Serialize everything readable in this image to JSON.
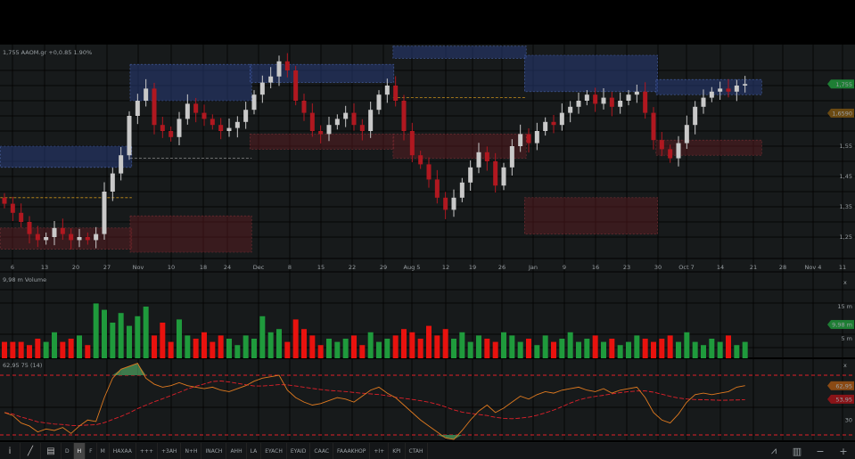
{
  "header": {
    "quote_line": "1,755 AAOM.gr +0,0.85 1.90%"
  },
  "price_axis": {
    "ticks": [
      {
        "label": "1,55",
        "value": 1.55
      },
      {
        "label": "1,45",
        "value": 1.45
      },
      {
        "label": "1,35",
        "value": 1.35
      },
      {
        "label": "1,25",
        "value": 1.25
      }
    ],
    "last_price_label": "1,755",
    "last_price_value": 1.755,
    "ref_price_label": "1,6590",
    "ref_price_value": 1.659,
    "last_color": "#1e7e34",
    "ref_color": "#6b4a12"
  },
  "x_axis": {
    "labels": [
      "6",
      "13",
      "20",
      "27",
      "Nov",
      "10",
      "18",
      "24",
      "Dec",
      "8",
      "15",
      "22",
      "29",
      "Aug 5",
      "12",
      "19",
      "26",
      "Jan",
      "9",
      "16",
      "23",
      "30",
      "Oct 7",
      "14",
      "21",
      "28",
      "Nov 4",
      "11"
    ]
  },
  "volume_panel": {
    "title": "9,98 m Volume",
    "close_label": "x",
    "ticks": [
      {
        "label": "15 m",
        "value": 15
      },
      {
        "label": "5 m",
        "value": 5
      }
    ],
    "last_label": "9,98 m"
  },
  "rsi_panel": {
    "title": "62,95 75 (14)",
    "close_label": "x",
    "upper": 70,
    "lower": 30,
    "value_label": "62,95",
    "value": 62.95,
    "ma_label": "53,95",
    "ma_value": 53.95,
    "extra_label": "30"
  },
  "chart_data": {
    "type": "candlestick",
    "ylim": [
      1.2,
      1.87
    ],
    "colors": {
      "up": "#c9c9c9",
      "down": "#b01820",
      "vol_up": "#1f9a3c",
      "vol_down": "#e8120e",
      "rsi": "#e07a1f",
      "rsi_ma": "#e0202a"
    },
    "closes": [
      1.36,
      1.33,
      1.3,
      1.26,
      1.24,
      1.25,
      1.28,
      1.26,
      1.24,
      1.25,
      1.24,
      1.26,
      1.4,
      1.46,
      1.52,
      1.65,
      1.7,
      1.74,
      1.62,
      1.6,
      1.58,
      1.64,
      1.69,
      1.66,
      1.64,
      1.62,
      1.6,
      1.61,
      1.63,
      1.67,
      1.72,
      1.76,
      1.78,
      1.83,
      1.8,
      1.7,
      1.66,
      1.6,
      1.59,
      1.62,
      1.64,
      1.66,
      1.62,
      1.6,
      1.67,
      1.72,
      1.75,
      1.7,
      1.6,
      1.52,
      1.49,
      1.44,
      1.38,
      1.34,
      1.38,
      1.43,
      1.48,
      1.53,
      1.5,
      1.42,
      1.48,
      1.55,
      1.59,
      1.56,
      1.6,
      1.63,
      1.62,
      1.66,
      1.68,
      1.7,
      1.72,
      1.69,
      1.71,
      1.68,
      1.7,
      1.72,
      1.73,
      1.66,
      1.57,
      1.54,
      1.51,
      1.56,
      1.62,
      1.68,
      1.71,
      1.73,
      1.74,
      1.73,
      1.75,
      1.755
    ],
    "volumes_m": [
      4,
      4,
      4,
      3,
      5,
      4,
      7,
      4,
      5,
      6,
      3,
      16,
      14,
      10,
      13,
      9,
      12,
      15,
      6,
      10,
      4,
      11,
      6,
      5,
      7,
      4,
      6,
      5,
      3,
      6,
      5,
      12,
      7,
      8,
      4,
      11,
      8,
      6,
      3,
      5,
      4,
      5,
      6,
      3,
      7,
      4,
      5,
      6,
      8,
      7,
      5,
      9,
      6,
      8,
      5,
      7,
      4,
      6,
      5,
      4,
      7,
      6,
      4,
      5,
      3,
      6,
      4,
      5,
      7,
      4,
      5,
      6,
      4,
      5,
      3,
      4,
      6,
      5,
      4,
      5,
      6,
      4,
      7,
      4,
      3,
      5,
      4,
      6,
      3,
      4
    ],
    "rsi": [
      45,
      43,
      38,
      36,
      32,
      34,
      33,
      35,
      31,
      36,
      40,
      39,
      55,
      68,
      74,
      76,
      78,
      68,
      64,
      62,
      63,
      65,
      63,
      62,
      61,
      62,
      60,
      59,
      61,
      63,
      66,
      68,
      69,
      70,
      60,
      55,
      52,
      50,
      51,
      53,
      55,
      54,
      52,
      56,
      60,
      62,
      58,
      55,
      50,
      45,
      40,
      36,
      32,
      28,
      27,
      33,
      40,
      46,
      50,
      45,
      48,
      52,
      56,
      54,
      57,
      59,
      58,
      60,
      61,
      62,
      60,
      59,
      61,
      58,
      60,
      61,
      62,
      55,
      45,
      40,
      38,
      44,
      52,
      57,
      58,
      57,
      58,
      59,
      62,
      63
    ],
    "supply_zones": [
      {
        "from": 0,
        "to": 15.3,
        "high": 1.55,
        "low": 1.48
      },
      {
        "from": 15.6,
        "to": 29.7,
        "high": 1.82,
        "low": 1.7
      },
      {
        "from": 30,
        "to": 46.8,
        "high": 1.82,
        "low": 1.76
      },
      {
        "from": 47.2,
        "to": 62.7,
        "high": 1.88,
        "low": 1.84
      },
      {
        "from": 63,
        "to": 78.5,
        "high": 1.85,
        "low": 1.73
      },
      {
        "from": 78.8,
        "to": 91,
        "high": 1.77,
        "low": 1.72
      }
    ],
    "demand_zones": [
      {
        "from": 0,
        "to": 15.3,
        "high": 1.28,
        "low": 1.21
      },
      {
        "from": 15.6,
        "to": 29.7,
        "high": 1.32,
        "low": 1.2
      },
      {
        "from": 30,
        "to": 46.8,
        "high": 1.59,
        "low": 1.54
      },
      {
        "from": 47.2,
        "to": 62.7,
        "high": 1.59,
        "low": 1.51
      },
      {
        "from": 63,
        "to": 78.5,
        "high": 1.38,
        "low": 1.26
      },
      {
        "from": 78.8,
        "to": 91,
        "high": 1.57,
        "low": 1.52
      }
    ],
    "levels": [
      {
        "from": 0,
        "to": 15.3,
        "price": 1.38,
        "color": "#c8901a"
      },
      {
        "from": 15.6,
        "to": 29.7,
        "price": 1.51,
        "color": "#8a8a8a"
      },
      {
        "from": 47.2,
        "to": 62.7,
        "price": 1.71,
        "color": "#c8901a"
      }
    ]
  },
  "toolbar": {
    "items": [
      "D",
      "H",
      "F",
      "M",
      "HAXAA",
      "+++",
      "+3AH",
      "N+H",
      "INACH",
      "AHH",
      "LA",
      "EYACH",
      "EYAID",
      "CAAC",
      "FAAAKHOP",
      "+I+",
      "KPI",
      "CTAH"
    ],
    "active": "H",
    "info_icon": "i",
    "draw_icon": "╱",
    "grid_icon": "▤",
    "right_icons": [
      "⩘",
      "▥",
      "−",
      "+"
    ]
  }
}
